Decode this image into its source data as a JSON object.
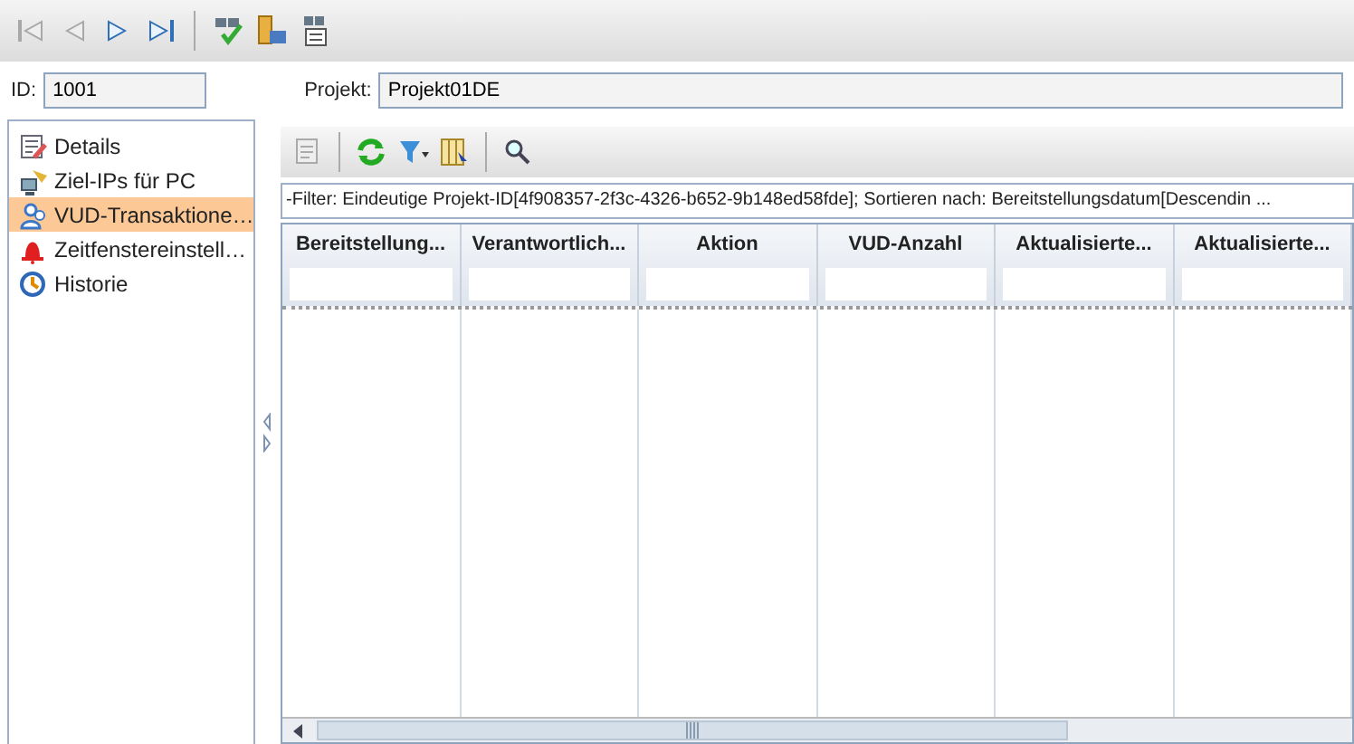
{
  "toolbar": {
    "nav_buttons": [
      {
        "kind": "first",
        "disabled": true
      },
      {
        "kind": "prev",
        "disabled": true
      },
      {
        "kind": "next",
        "disabled": false
      },
      {
        "kind": "last",
        "disabled": false
      }
    ]
  },
  "header": {
    "id_label": "ID:",
    "id_value": "1001",
    "project_label": "Projekt:",
    "project_value": "Projekt01DE"
  },
  "sidebar": {
    "items": [
      {
        "kind": "details",
        "label": "Details",
        "selected": false
      },
      {
        "kind": "ips",
        "label": "Ziel-IPs für PC",
        "selected": false
      },
      {
        "kind": "users",
        "label": "VUD-Transaktione…",
        "selected": true
      },
      {
        "kind": "alarm",
        "label": "Zeitfenstereinstell…",
        "selected": false
      },
      {
        "kind": "history",
        "label": "Historie",
        "selected": false
      }
    ]
  },
  "grid": {
    "filter": "-Filter:  Eindeutige Projekt-ID[4f908357-2f3c-4326-b652-9b148ed58fde];  Sortieren  nach:  Bereitstellungsdatum[Descendin  ...",
    "columns": [
      "Bereitstellung...",
      "Verantwortlich...",
      "Aktion",
      "VUD-Anzahl",
      "Aktualisierte...",
      "Aktualisierte..."
    ]
  }
}
